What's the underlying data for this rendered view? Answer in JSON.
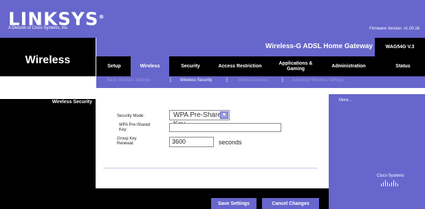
{
  "brand": {
    "logo_text": "LINKSYS",
    "registered_mark": "®",
    "tagline": "A Division of Cisco Systems, Inc.",
    "firmware": "Firmware Version: v1.00.16"
  },
  "header": {
    "section_title": "Wireless",
    "product_name": "Wireless-G ADSL Home Gateway",
    "model": "WAG54G V.3"
  },
  "tabs": [
    {
      "label": "Setup",
      "active": false
    },
    {
      "label": "Wireless",
      "active": true
    },
    {
      "label": "Security",
      "active": false
    },
    {
      "label": "Access Restriction",
      "active": false
    },
    {
      "label": "Applications & Gaming",
      "active": false
    },
    {
      "label": "Administration",
      "active": false
    },
    {
      "label": "Status",
      "active": false
    }
  ],
  "subtabs": [
    {
      "label": "Basic Wireless Settings",
      "active": false
    },
    {
      "label": "Wireless Security",
      "active": true
    },
    {
      "label": "Wireless Access",
      "active": false
    },
    {
      "label": "Advanced Wireless Settings",
      "active": false
    }
  ],
  "sidebar": {
    "label": "Wireless Security"
  },
  "form": {
    "security_mode_label": "Security Mode:",
    "security_mode_value": "WPA Pre-Shared Key",
    "preshared_key_label_line1": "WPA Pre-Shared",
    "preshared_key_label_line2": "Key:",
    "preshared_key_value": "",
    "group_key_label_line1": "Group Key",
    "group_key_label_line2": "Renewal:",
    "group_key_value": "3600",
    "seconds_label": "seconds"
  },
  "help": {
    "more_link": "More..."
  },
  "footer": {
    "save_label": "Save Settings",
    "cancel_label": "Cancel Changes",
    "cisco_label": "Cisco Systems"
  },
  "colors": {
    "brand_purple": "#6666cc",
    "black": "#000000"
  }
}
